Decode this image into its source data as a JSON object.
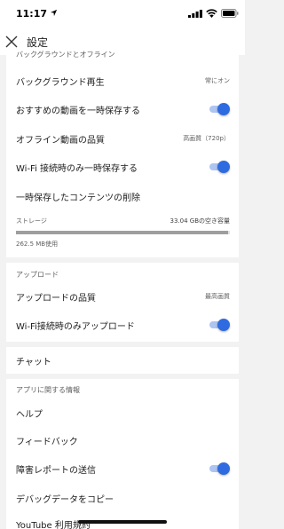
{
  "status_bar": {
    "time": "11:17",
    "icons": [
      "location-arrow-icon",
      "cellular-signal-icon",
      "wifi-icon",
      "battery-icon"
    ]
  },
  "app_bar": {
    "close_icon": "close-icon",
    "title": "設定"
  },
  "section_background": {
    "header": "バックグラウンドとオフライン",
    "items": [
      {
        "label": "バックグラウンド再生",
        "value": "常にオン"
      },
      {
        "label": "おすすめの動画を一時保存する",
        "toggle": true
      },
      {
        "label": "オフライン動画の品質",
        "value": "高画質（720p）"
      },
      {
        "label": "Wi-Fi 接続時のみ一時保存する",
        "toggle": true
      },
      {
        "label": "一時保存したコンテンツの削除"
      }
    ],
    "storage": {
      "label": "ストレージ",
      "free": "33.04 GBの空き容量",
      "used": "262.5 MB使用",
      "used_fraction": 0.99
    }
  },
  "section_upload": {
    "header": "アップロード",
    "items": [
      {
        "label": "アップロードの品質",
        "value": "最高画質"
      },
      {
        "label": "Wi-Fi接続時のみアップロード",
        "toggle": true
      }
    ]
  },
  "section_chat": {
    "items": [
      {
        "label": "チャット"
      }
    ]
  },
  "section_about": {
    "header": "アプリに関する情報",
    "items": [
      {
        "label": "ヘルプ"
      },
      {
        "label": "フィードバック"
      },
      {
        "label": "障害レポートの送信",
        "toggle": true
      },
      {
        "label": "デバッグデータをコピー"
      },
      {
        "label": "YouTube 利用規約"
      }
    ]
  },
  "colors": {
    "accent": "#2f6be0",
    "track": "#aec5f2",
    "background": "#f2f2f2"
  }
}
